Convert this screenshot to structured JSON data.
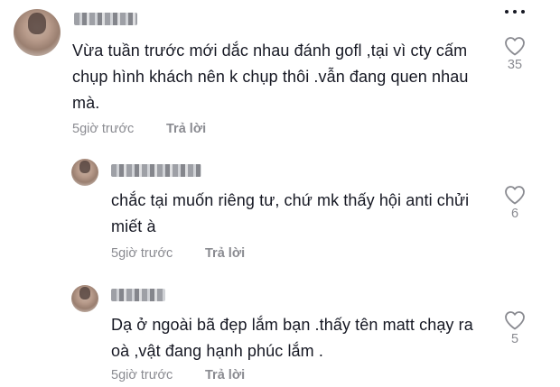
{
  "comments": [
    {
      "text_line1": "Vừa tuần trước mới dắc nhau đánh gofl ,tại vì cty cấm",
      "text_line2": "chụp hình khách nên k chụp thôi .vẫn đang quen nhau",
      "text_line3": "mà.",
      "time": "5giờ trước",
      "reply_label": "Trả lời",
      "likes": "35"
    },
    {
      "text_line1": "chắc tại muốn riêng tư, chứ mk thấy hội anti chửi",
      "text_line2": "miết à",
      "time": "5giờ trước",
      "reply_label": "Trả lời",
      "likes": "6"
    },
    {
      "text_line1": "Dạ ở ngoài bã đẹp lắm bạn .thấy tên matt chạy ra",
      "text_line2": "oà ,vật đang hạnh phúc lắm .",
      "time": "5giờ trước",
      "reply_label": "Trả lời",
      "likes": "5"
    }
  ],
  "icons": {
    "more": "more-dots-icon",
    "like": "heart-outline-icon"
  },
  "colors": {
    "text": "#161823",
    "secondary": "#8a8b91",
    "background": "#ffffff"
  }
}
